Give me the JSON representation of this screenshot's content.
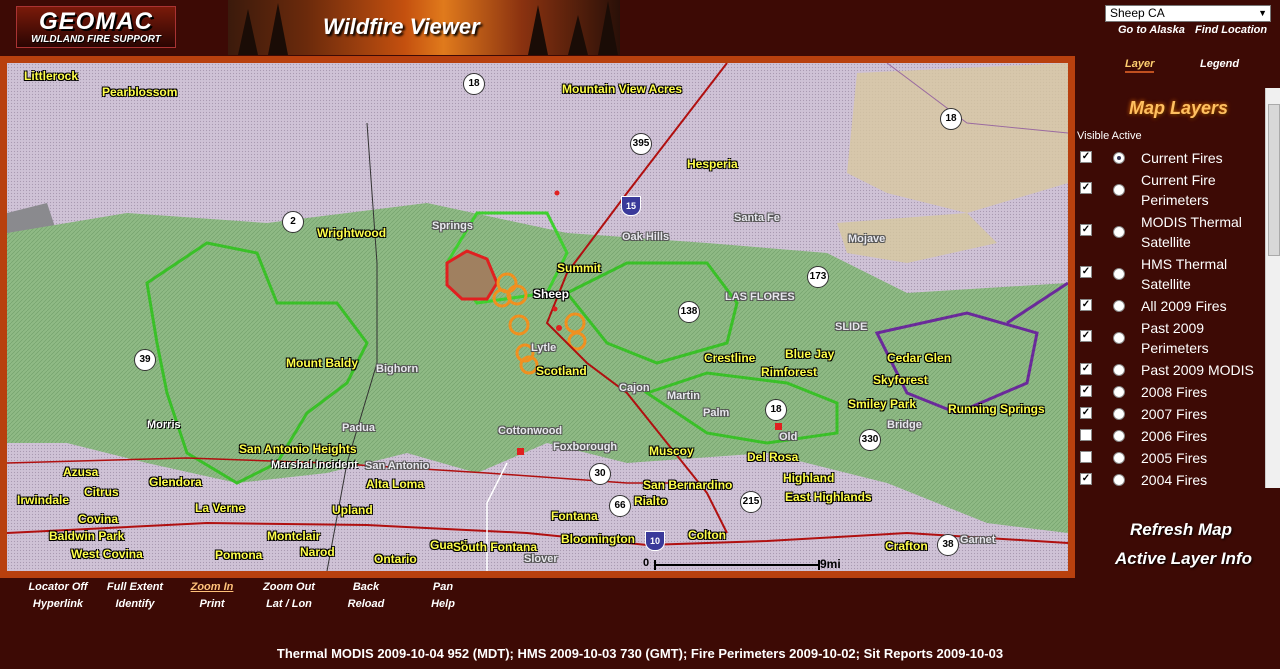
{
  "header": {
    "logo_title": "GEOMAC",
    "logo_subtitle": "WILDLAND FIRE SUPPORT",
    "banner_title": "Wildfire Viewer"
  },
  "sidebar": {
    "location_select": "Sheep CA",
    "go_alaska": "Go to Alaska",
    "find_location": "Find Location",
    "tab_layer": "Layer",
    "tab_legend": "Legend",
    "map_layers_title": "Map Layers",
    "visible_active": "Visible Active",
    "layers": [
      {
        "label": "Current Fires",
        "visible": true,
        "active": true
      },
      {
        "label": "Current Fire Perimeters",
        "visible": true,
        "active": false
      },
      {
        "label": "MODIS Thermal Satellite",
        "visible": true,
        "active": false
      },
      {
        "label": "HMS Thermal Satellite",
        "visible": true,
        "active": false
      },
      {
        "label": "All 2009 Fires",
        "visible": true,
        "active": false
      },
      {
        "label": "Past 2009 Perimeters",
        "visible": true,
        "active": false
      },
      {
        "label": "Past 2009 MODIS",
        "visible": true,
        "active": false
      },
      {
        "label": "2008 Fires",
        "visible": true,
        "active": false
      },
      {
        "label": "2007 Fires",
        "visible": true,
        "active": false
      },
      {
        "label": "2006 Fires",
        "visible": false,
        "active": false
      },
      {
        "label": "2005 Fires",
        "visible": false,
        "active": false
      },
      {
        "label": "2004 Fires",
        "visible": true,
        "active": false
      }
    ],
    "refresh_map": "Refresh Map",
    "active_layer_info": "Active Layer Info"
  },
  "toolbar": {
    "row1": [
      "Locator Off",
      "Full Extent",
      "Zoom In",
      "Zoom Out",
      "Back",
      "Pan"
    ],
    "row2": [
      "Hyperlink",
      "Identify",
      "Print",
      "Lat / Lon",
      "Reload",
      "Help"
    ],
    "active": "Zoom In"
  },
  "map": {
    "places": {
      "littlerock": "Littlerock",
      "pearblossom": "Pearblossom",
      "mountain_view_acres": "Mountain View Acres",
      "hesperia": "Hesperia",
      "santa_fe": "Santa Fe",
      "oak_hills": "Oak Hills",
      "mojave": "Mojave",
      "wrightwood": "Wrightwood",
      "springs": "Springs",
      "summit": "Summit",
      "sheep": "Sheep",
      "las_flores": "LAS FLORES",
      "slide": "SLIDE",
      "lytle": "Lytle",
      "scotland": "Scotland",
      "mount_baldy": "Mount Baldy",
      "bighorn": "Bighorn",
      "crestline": "Crestline",
      "blue_jay": "Blue Jay",
      "cedar_glen": "Cedar Glen",
      "rimforest": "Rimforest",
      "skyforest": "Skyforest",
      "cajon": "Cajon",
      "martin": "Martin",
      "palm": "Palm",
      "smiley_park": "Smiley Park",
      "running_springs": "Running Springs",
      "bridge": "Bridge",
      "morris": "Morris",
      "padua": "Padua",
      "cottonwood": "Cottonwood",
      "foxborough": "Foxborough",
      "old": "Old",
      "san_antonio_heights": "San Antonio Heights",
      "marshal_incident": "Marshal Incident",
      "san_antonio": "San Antonio",
      "muscoy": "Muscoy",
      "del_rosa": "Del Rosa",
      "highland": "Highland",
      "azusa": "Azusa",
      "glendora": "Glendora",
      "alta_loma": "Alta Loma",
      "san_bernardino": "San Bernardino",
      "east_highlands": "East Highlands",
      "irwindale": "Irwindale",
      "citrus": "Citrus",
      "la_verne": "La Verne",
      "upland": "Upland",
      "rialto": "Rialto",
      "covina": "Covina",
      "fontana": "Fontana",
      "baldwin_park": "Baldwin Park",
      "montclair": "Montclair",
      "colton": "Colton",
      "west_covina": "West Covina",
      "pomona": "Pomona",
      "narod": "Narod",
      "guasti": "Guasti",
      "south_fontana": "South Fontana",
      "bloomington": "Bloomington",
      "crafton": "Crafton",
      "garnet": "Garnet",
      "ontario": "Ontario",
      "slover": "Slover"
    },
    "routes": [
      "18",
      "395",
      "15",
      "18",
      "2",
      "173",
      "138",
      "39",
      "18",
      "330",
      "215",
      "30",
      "66",
      "10",
      "38"
    ],
    "scale_start": "0",
    "scale_end": "9mi"
  },
  "status": "Thermal MODIS 2009-10-04 952 (MDT); HMS 2009-10-03 730 (GMT); Fire Perimeters 2009-10-02; Sit Reports 2009-10-03",
  "colors": {
    "background": "#3d0a05",
    "frame": "#b8400e",
    "label_yellow": "#ffff4a",
    "vegetation": "#7fb27a",
    "desert": "#c9bcd0",
    "fire_red": "#e02020",
    "fire_orange": "#f09020"
  }
}
